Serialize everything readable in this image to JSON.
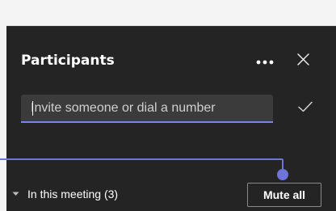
{
  "panel": {
    "title": "Participants"
  },
  "header_actions": {
    "more_icon": "more-options-icon",
    "close_icon": "close-icon"
  },
  "invite": {
    "placeholder": "Invite someone or dial a number",
    "confirm_icon": "checkmark-icon"
  },
  "meeting_section": {
    "label": "In this meeting (3)",
    "chevron_icon": "chevron-down-icon"
  },
  "actions": {
    "mute_all_label": "Mute all"
  },
  "colors": {
    "panel_background": "#242424",
    "accent": "#6f74d8",
    "input_background": "#3b3b3b"
  }
}
